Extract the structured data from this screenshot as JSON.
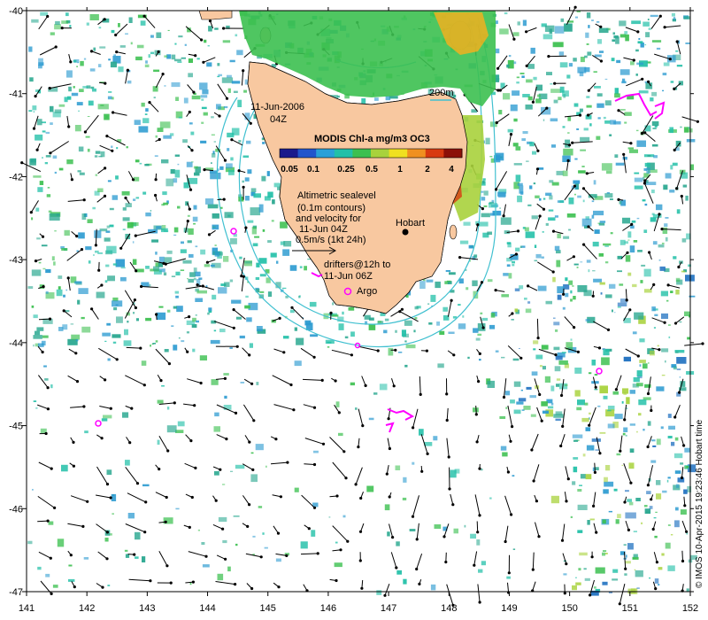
{
  "map": {
    "lon_ticks": [
      "141",
      "142",
      "143",
      "144",
      "145",
      "146",
      "147",
      "148",
      "149",
      "150",
      "151",
      "152"
    ],
    "lat_ticks": [
      "-40",
      "-41",
      "-42",
      "-43",
      "-44",
      "-45",
      "-46",
      "-47"
    ],
    "lon_range": [
      141,
      152
    ],
    "lat_range": [
      -47,
      -40
    ],
    "date_line1": "11-Jun-2006",
    "date_line2": "04Z",
    "colorbar_title": "MODIS Chl-a mg/m3 OC3",
    "colorbar_ticks": [
      "0.05",
      "0.1",
      "0.25",
      "0.5",
      "1",
      "2",
      "4"
    ],
    "colorbar_colors": [
      "#1a1a8c",
      "#2255cc",
      "#2aa0d8",
      "#22c0a8",
      "#3cc050",
      "#a8d23c",
      "#f0e020",
      "#f09020",
      "#d83a10",
      "#8c1008"
    ],
    "contour_label": "200m",
    "altimetry_lines": [
      "Altimetric sealevel",
      "(0.1m contours)",
      "and velocity for",
      "11-Jun 04Z",
      "0.5m/s (1kt 24h)"
    ],
    "drifters_lines": [
      "drifters@12h to",
      "11-Jun 06Z"
    ],
    "argo_label": "Argo",
    "city_label": "Hobart",
    "credit": "© IMOS 10-Apr-2015 19:23:46 Hobart time",
    "colors": {
      "land": "#f8c8a0",
      "chl_low": "#2aa890",
      "chl_mid": "#3cc050",
      "drifter": "#ff00ff",
      "contour": "#40c0d0",
      "arrow": "#000000"
    }
  }
}
